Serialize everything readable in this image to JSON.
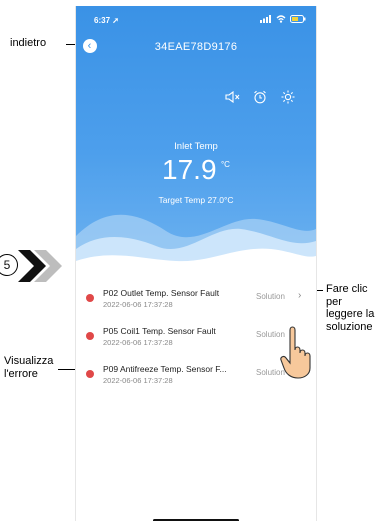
{
  "status_bar": {
    "time": "6:37"
  },
  "header": {
    "device_id": "34EAE78D9176"
  },
  "readings": {
    "inlet_label": "Inlet Temp",
    "inlet_value": "17.9",
    "inlet_unit": "°C",
    "target_label": "Target Temp",
    "target_value": "27.0°C"
  },
  "errors": [
    {
      "title": "P02 Outlet Temp. Sensor Fault",
      "time": "2022-06-06 17:37:28",
      "action": "Solution"
    },
    {
      "title": "P05 Coil1 Temp. Sensor Fault",
      "time": "2022-06-06 17:37:28",
      "action": "Solution"
    },
    {
      "title": "P09 Antifreeze Temp. Sensor F...",
      "time": "2022-06-06 17:37:28",
      "action": "Solution"
    }
  ],
  "annotations": {
    "back": "indietro",
    "step": "5",
    "view_error": "Visualizza\nl'errore",
    "tap_solution": "Fare clic\nper\nleggere la\nsoluzione"
  },
  "icons": [
    "back-icon",
    "mute-icon",
    "alarm-icon",
    "brightness-icon",
    "chevron-right-icon",
    "error-dot-icon",
    "hand-pointer-icon",
    "double-chevron-icon"
  ],
  "colors": {
    "header_blue": "#3a92e6",
    "error_red": "#e04848"
  }
}
